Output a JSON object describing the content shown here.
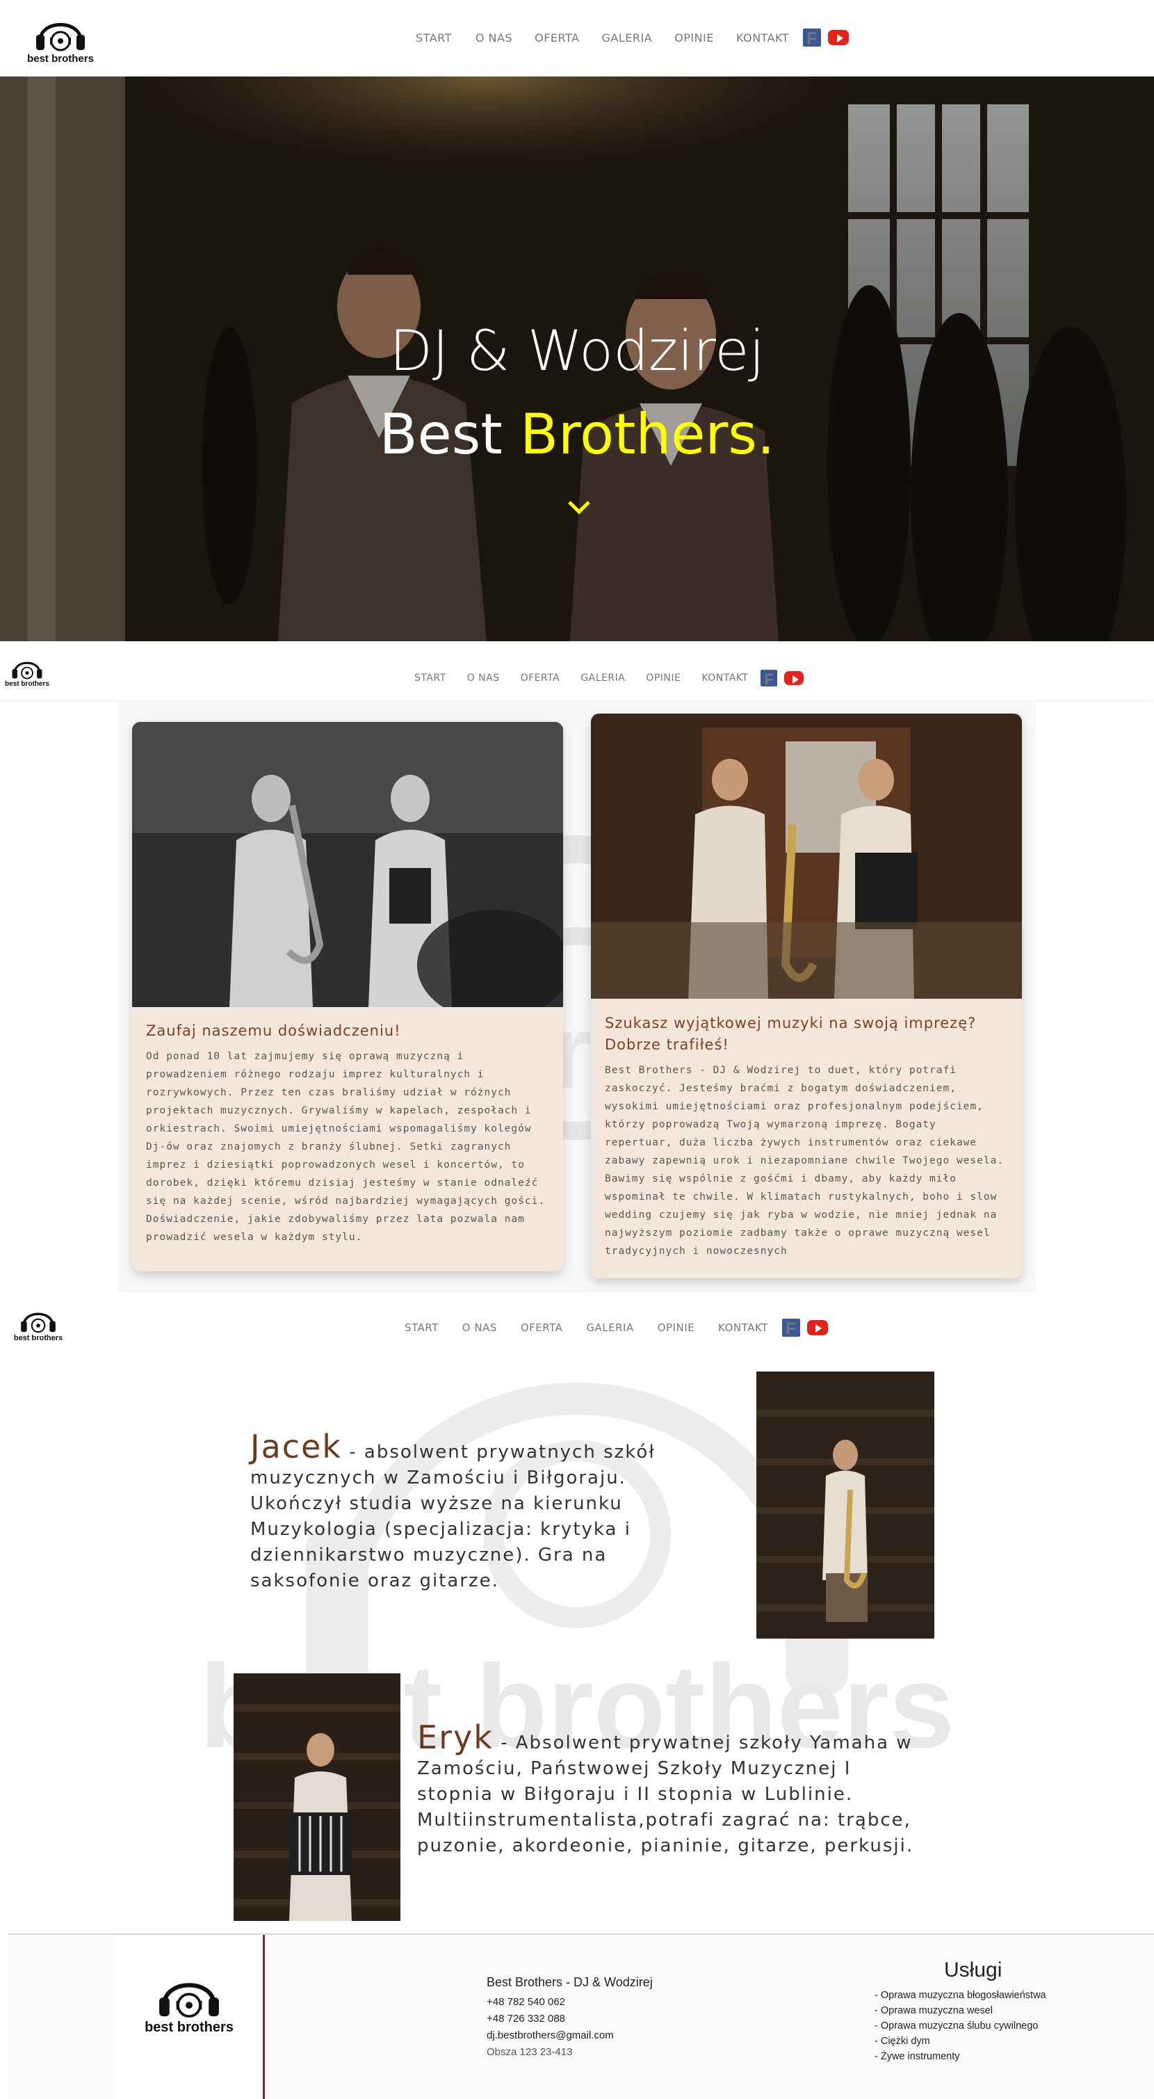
{
  "logo": {
    "text": "best brothers"
  },
  "nav": {
    "items": [
      "START",
      "O NAS",
      "OFERTA",
      "GALERIA",
      "OPINIE",
      "KONTAKT"
    ],
    "facebook": "f"
  },
  "hero": {
    "line1": "DJ & Wodzirej",
    "line2_white": "Best ",
    "line2_yellow": "Brothers.",
    "accent": "#ffff00"
  },
  "about": {
    "card1": {
      "title": "Zaufaj naszemu doświadczeniu!",
      "text": "Od ponad 10 lat zajmujemy się oprawą muzyczną i prowadzeniem różnego rodzaju imprez kulturalnych i rozrywkowych. Przez ten czas braliśmy udział w różnych projektach muzycznych. Grywaliśmy w kapelach, zespołach i orkiestrach. Swoimi umiejętnościami wspomagaliśmy kolegów Dj-ów oraz znajomych z branży ślubnej. Setki zagranych imprez i dziesiątki poprowadzonych wesel i koncertów, to dorobek, dzięki któremu dzisiaj jesteśmy w stanie odnaleźć się na każdej scenie, wśród najbardziej wymagających gości. Doświadczenie, jakie zdobywaliśmy przez lata pozwala nam prowadzić wesela w każdym stylu."
    },
    "card2": {
      "title": "Szukasz wyjątkowej muzyki na swoją imprezę? Dobrze trafiłeś!",
      "text": "Best Brothers - DJ & Wodzirej to duet, który potrafi zaskoczyć. Jesteśmy braćmi z bogatym doświadczeniem, wysokimi umiejętnościami oraz profesjonalnym podejściem, którzy poprowadzą Twoją wymarzoną imprezę. Bogaty repertuar, duża liczba żywych instrumentów oraz ciekawe zabawy zapewnią urok i niezapomniane chwile Twojego wesela. Bawimy się wspólnie z gośćmi i dbamy, aby każdy miło wspominał te chwile. W klimatach rustykalnych, boho i slow wedding czujemy się jak ryba w wodzie, nie mniej jednak na najwyższym poziomie zadbamy także o oprawe muzyczną wesel tradycyjnych i nowoczesnych"
    }
  },
  "team": {
    "watermark": "best brothers",
    "jacek": {
      "name": "Jacek",
      "text": " - absolwent prywatnych szkół muzycznych w Zamościu i Biłgoraju. Ukończył studia wyższe na kierunku Muzykologia (specjalizacja: krytyka i dziennikarstwo muzyczne). Gra na saksofonie oraz gitarze."
    },
    "eryk": {
      "name": "Eryk",
      "text": " - Absolwent prywatnej szkoły Yamaha w Zamościu, Państwowej Szkoły Muzycznej I stopnia w Biłgoraju i II stopnia w Lublinie. Multiinstrumentalista,potrafi zagrać na: trąbce, puzonie, akordeonie, pianinie, gitarze, perkusji."
    }
  },
  "footer": {
    "company": "Best Brothers - DJ & Wodzirej",
    "phone1": "+48 782 540 062",
    "phone2": "+48 726 332 088",
    "email": "dj.bestbrothers@gmail.com",
    "address": "Obsza 123 23-413",
    "services_title": "Usługi",
    "services": [
      "- Oprawa muzyczna błogosławieństwa",
      "- Oprawa muzyczna wesel",
      "- Oprawa muzyczna ślubu cywilnego",
      "- Ciężki dym",
      "- Żywe instrumenty"
    ]
  }
}
